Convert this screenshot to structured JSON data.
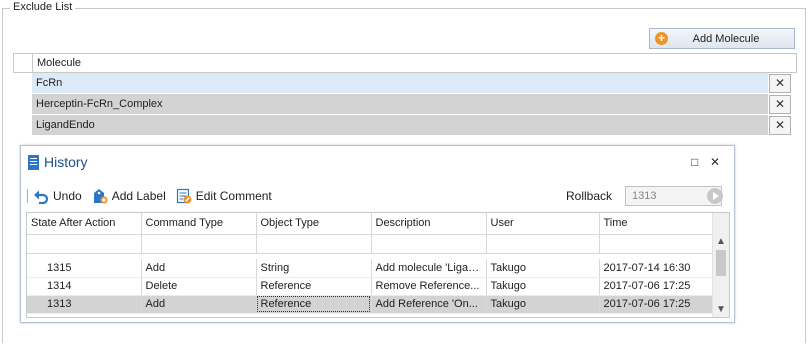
{
  "exclude_list": {
    "title": "Exclude List",
    "add_button": "Add Molecule",
    "column_header": "Molecule",
    "molecules": [
      "FcRn",
      "Herceptin-FcRn_Complex",
      "LigandEndo"
    ],
    "delete_glyph": "✕"
  },
  "history": {
    "title": "History",
    "window_controls": {
      "maximize": "□",
      "close": "✕"
    },
    "toolbar": {
      "undo": "Undo",
      "add_label": "Add Label",
      "edit_comment": "Edit Comment",
      "rollback_label": "Rollback",
      "rollback_value": "1313"
    },
    "columns": [
      "State After Action",
      "Command Type",
      "Object Type",
      "Description",
      "User",
      "Time"
    ],
    "rows": [
      [
        "1315",
        "Add",
        "String",
        "Add molecule 'Ligan...",
        "Takugo",
        "2017-07-14 16:30"
      ],
      [
        "1314",
        "Delete",
        "Reference",
        "Remove Reference...",
        "Takugo",
        "2017-07-06 17:25"
      ],
      [
        "1313",
        "Add",
        "Reference",
        "Add Reference 'On...",
        "Takugo",
        "2017-07-06 17:25"
      ]
    ],
    "selected_row_index": 2
  },
  "icons": {
    "add": "plus-circle-icon",
    "undo": "undo-arrow-icon",
    "add_label": "tag-add-icon",
    "edit_comment": "edit-comment-icon",
    "play": "play-icon",
    "history": "document-list-icon"
  },
  "colors": {
    "selected_row": "#dce9f7",
    "gray_row": "#d3d3d3",
    "accent_blue": "#2b76c6",
    "add_icon": "#f0932b"
  }
}
